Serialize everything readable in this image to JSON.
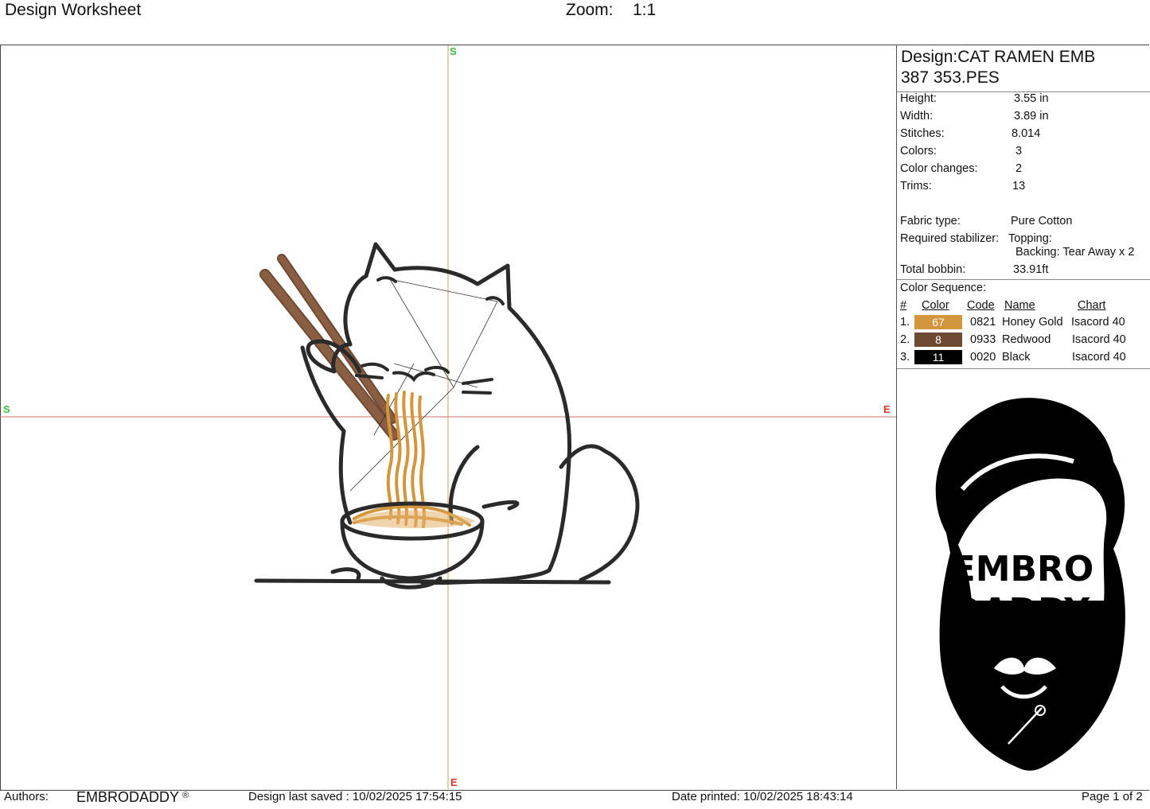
{
  "header": {
    "title": "Design Worksheet",
    "zoom_label": "Zoom:",
    "zoom_value": "1:1"
  },
  "axes": {
    "north": "S",
    "south": "E",
    "west": "S",
    "east": "E"
  },
  "design": {
    "name_line1": "Design:CAT RAMEN EMB",
    "name_line2": "387 353.PES",
    "stats": [
      {
        "label": "Height:",
        "value": "3.55 in"
      },
      {
        "label": "Width:",
        "value": "3.89 in"
      },
      {
        "label": "Stitches:",
        "value": "8.014"
      },
      {
        "label": "Colors:",
        "value": "3"
      },
      {
        "label": "Color changes:",
        "value": "2"
      },
      {
        "label": "Trims:",
        "value": "13"
      }
    ],
    "fabric_label": "Fabric type:",
    "fabric_value": "Pure Cotton",
    "stabilizer_label": "Required stabilizer:",
    "topping": "Topping:",
    "backing": "Backing: Tear Away x 2",
    "bobbin_label": "Total bobbin:",
    "bobbin_value": "33.91ft"
  },
  "color_sequence": {
    "title": "Color Sequence:",
    "headers": {
      "num": "#",
      "color": "Color",
      "code": "Code",
      "name": "Name",
      "chart": "Chart"
    },
    "rows": [
      {
        "num": "1.",
        "swatch": "67",
        "hex": "#D3963C",
        "code": "0821",
        "name": "Honey Gold",
        "chart": "Isacord 40"
      },
      {
        "num": "2.",
        "swatch": "8",
        "hex": "#6E4A33",
        "code": "0933",
        "name": "Redwood",
        "chart": "Isacord 40"
      },
      {
        "num": "3.",
        "swatch": "11",
        "hex": "#000000",
        "code": "0020",
        "name": "Black",
        "chart": "Isacord 40"
      }
    ]
  },
  "logo": {
    "line1": "EMBRO",
    "line2": "DADDY"
  },
  "footer": {
    "authors_label": "Authors:",
    "authors_value": "EMBRODADDY",
    "reg": "®",
    "saved": "Design last saved : 10/02/2025 17:54:15",
    "printed": "Date printed: 10/02/2025 18:43:14",
    "page": "Page 1 of 2"
  }
}
